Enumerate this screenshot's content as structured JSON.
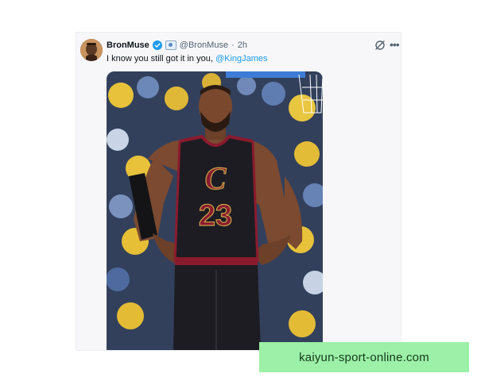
{
  "tweet": {
    "display_name": "BronMuse",
    "handle": "@BronMuse",
    "separator": "·",
    "timestamp": "2h",
    "text_before": "I know you still got it in you, ",
    "mention": "@KingJames",
    "icons": {
      "verified": "verified-check-icon",
      "affiliate": "affiliate-badge-icon",
      "grok": "grok-icon",
      "more": "more-options-icon"
    },
    "media": {
      "jersey_brand": "C",
      "jersey_number": "23",
      "colors": {
        "jersey": "#1c1c22",
        "trim": "#8a1b2e",
        "accent": "#c8a24a",
        "crowd": "#e7c23a"
      }
    }
  },
  "watermark": {
    "text": "kaiyun-sport-online.com"
  },
  "colors": {
    "link": "#1d9bf0",
    "verified": "#1d9bf0",
    "watermark_bg": "#9cf0a7"
  }
}
